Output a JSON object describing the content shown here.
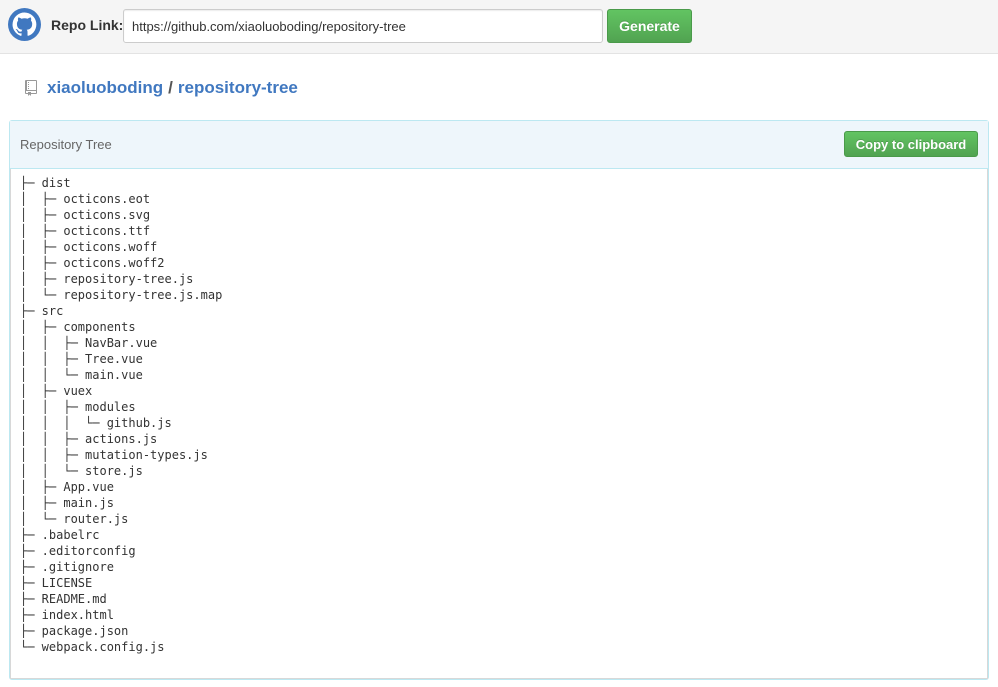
{
  "header": {
    "repo_link_label": "Repo Link:",
    "repo_link_value": "https://github.com/xiaoluoboding/repository-tree",
    "generate_label": "Generate"
  },
  "repo": {
    "owner": "xiaoluoboding",
    "separator": "/",
    "name": "repository-tree"
  },
  "panel": {
    "title": "Repository Tree",
    "copy_label": "Copy to clipboard"
  },
  "tree": [
    "├─ dist",
    "│  ├─ octicons.eot",
    "│  ├─ octicons.svg",
    "│  ├─ octicons.ttf",
    "│  ├─ octicons.woff",
    "│  ├─ octicons.woff2",
    "│  ├─ repository-tree.js",
    "│  └─ repository-tree.js.map",
    "├─ src",
    "│  ├─ components",
    "│  │  ├─ NavBar.vue",
    "│  │  ├─ Tree.vue",
    "│  │  └─ main.vue",
    "│  ├─ vuex",
    "│  │  ├─ modules",
    "│  │  │  └─ github.js",
    "│  │  ├─ actions.js",
    "│  │  ├─ mutation-types.js",
    "│  │  └─ store.js",
    "│  ├─ App.vue",
    "│  ├─ main.js",
    "│  └─ router.js",
    "├─ .babelrc",
    "├─ .editorconfig",
    "├─ .gitignore",
    "├─ LICENSE",
    "├─ README.md",
    "├─ index.html",
    "├─ package.json",
    "└─ webpack.config.js"
  ],
  "colors": {
    "link": "#4078c0",
    "button_green": "#5cb85c",
    "panel_border": "#bce8f1"
  },
  "icons": {
    "logo": "github-octocat-icon",
    "repo": "repo-book-icon"
  }
}
